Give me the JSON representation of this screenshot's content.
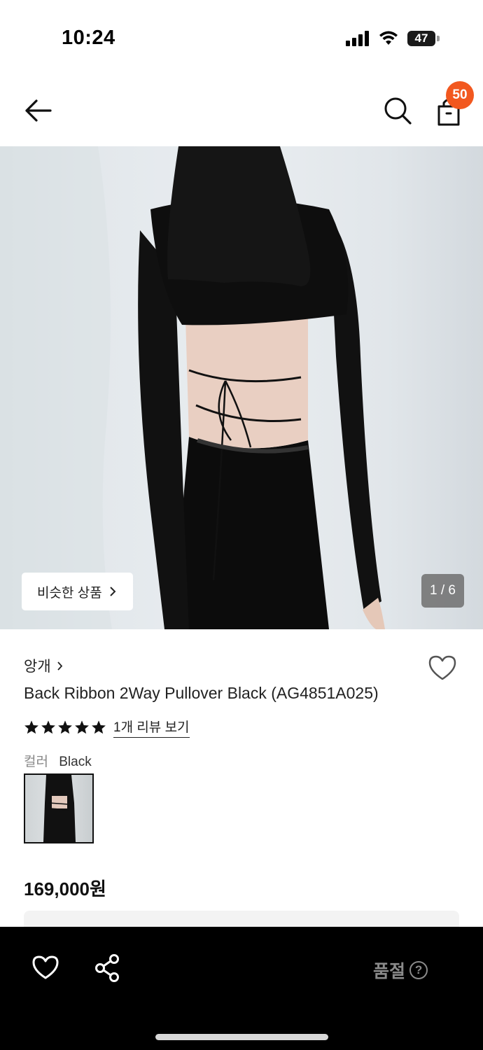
{
  "status_bar": {
    "time": "10:24",
    "battery": "47"
  },
  "header": {
    "cart_count": "50"
  },
  "hero": {
    "similar_button_label": "비슷한 상품",
    "page_indicator": "1 / 6"
  },
  "product": {
    "brand": "앙개",
    "title": "Back Ribbon 2Way Pullover Black (AG4851A025)",
    "rating_stars": 5,
    "review_link": "1개 리뷰 보기",
    "color_label": "컬러",
    "color_value": "Black",
    "price": "169,000원"
  },
  "bottom_bar": {
    "soldout_label": "품절",
    "help_glyph": "?"
  },
  "icons": {
    "back": "arrow-left-icon",
    "search": "search-icon",
    "cart": "shopping-bag-icon",
    "wishlist": "heart-icon",
    "share": "share-icon",
    "help": "question-circle-icon"
  },
  "colors": {
    "badge": "#f2581f",
    "bottom_bar": "#000000",
    "soldout_text": "#8a8a8a"
  }
}
